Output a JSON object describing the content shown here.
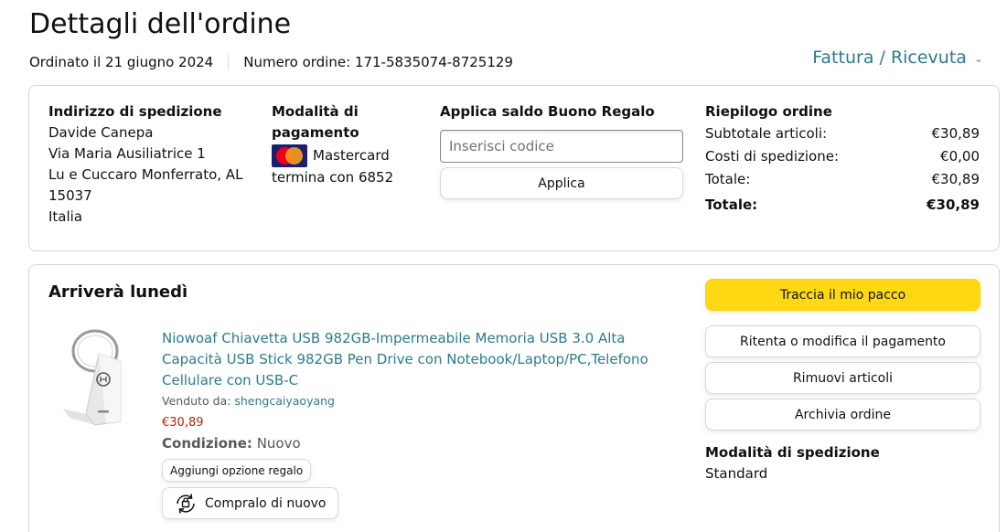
{
  "header": {
    "title": "Dettagli dell'ordine",
    "order_date": "Ordinato il 21 giugno 2024",
    "order_number": "Numero ordine: 171-5835074-8725129",
    "invoice_link": "Fattura / Ricevuta"
  },
  "shipping_address": {
    "title": "Indirizzo di spedizione",
    "name": "Davide Canepa",
    "street": "Via Maria Ausiliatrice 1",
    "city": "Lu e Cuccaro Monferrato, AL",
    "zip": "15037",
    "country": "Italia"
  },
  "payment": {
    "title_line1": "Modalità di",
    "title_line2": "pagamento",
    "card_name": "Mastercard",
    "card_ending": "termina con 6852"
  },
  "gift_card": {
    "title": "Applica saldo Buono Regalo",
    "placeholder": "Inserisci codice",
    "apply_label": "Applica"
  },
  "summary": {
    "title": "Riepilogo ordine",
    "rows": [
      {
        "label": "Subtotale articoli:",
        "value": "€30,89"
      },
      {
        "label": "Costi di spedizione:",
        "value": "€0,00"
      },
      {
        "label": "Totale:",
        "value": "€30,89"
      }
    ],
    "grand_total_label": "Totale:",
    "grand_total_value": "€30,89"
  },
  "shipment": {
    "arrival": "Arriverà lunedì",
    "product_title": "Niowoaf Chiavetta USB 982GB-Impermeabile Memoria USB 3.0 Alta Capacità USB Stick 982GB Pen Drive con Notebook/Laptop/PC,Telefono Cellulare con USB-C",
    "sold_by_label": "Venduto da:",
    "seller": "shengcaiyaoyang",
    "price": "€30,89",
    "condition_label": "Condizione:",
    "condition_value": "Nuovo",
    "gift_option": "Aggiungi opzione regalo",
    "rebuy": "Compralo di nuovo",
    "actions": {
      "track": "Traccia il mio pacco",
      "retry_payment": "Ritenta o modifica il pagamento",
      "remove_items": "Rimuovi articoli",
      "archive": "Archivia ordine"
    },
    "shipping_method_title": "Modalità di spedizione",
    "shipping_method_value": "Standard"
  },
  "colors": {
    "link": "#2a7c8f",
    "price": "#b12704",
    "track_button": "#ffd814",
    "border": "#d5d9d9"
  }
}
